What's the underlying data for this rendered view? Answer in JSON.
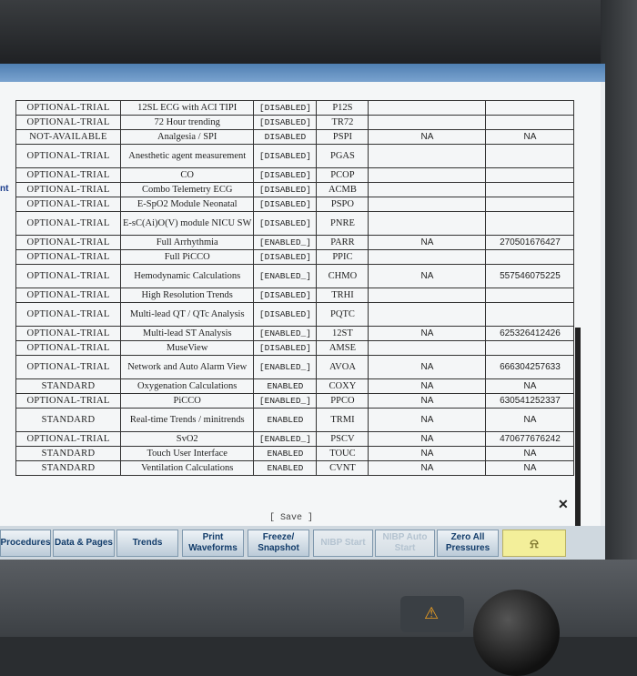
{
  "side_label": "nt",
  "rows": [
    {
      "status": "OPTIONAL-TRIAL",
      "option": "12SL ECG with ACI TIPI",
      "state": "[DISABLED]",
      "code": "P12S",
      "na": "",
      "key": ""
    },
    {
      "status": "OPTIONAL-TRIAL",
      "option": "72 Hour trending",
      "state": "[DISABLED]",
      "code": "TR72",
      "na": "",
      "key": ""
    },
    {
      "status": "NOT-AVAILABLE",
      "option": "Analgesia / SPI",
      "state": "DISABLED",
      "code": "PSPI",
      "na": "NA",
      "key": "NA"
    },
    {
      "status": "OPTIONAL-TRIAL",
      "option": "Anesthetic agent measurement",
      "state": "[DISABLED]",
      "code": "PGAS",
      "na": "",
      "key": ""
    },
    {
      "status": "OPTIONAL-TRIAL",
      "option": "CO",
      "state": "[DISABLED]",
      "code": "PCOP",
      "na": "",
      "key": ""
    },
    {
      "status": "OPTIONAL-TRIAL",
      "option": "Combo Telemetry ECG",
      "state": "[DISABLED]",
      "code": "ACMB",
      "na": "",
      "key": ""
    },
    {
      "status": "OPTIONAL-TRIAL",
      "option": "E-SpO2 Module Neonatal",
      "state": "[DISABLED]",
      "code": "PSPO",
      "na": "",
      "key": ""
    },
    {
      "status": "OPTIONAL-TRIAL",
      "option": "E-sC(Ai)O(V) module NICU SW",
      "state": "[DISABLED]",
      "code": "PNRE",
      "na": "",
      "key": ""
    },
    {
      "status": "OPTIONAL-TRIAL",
      "option": "Full Arrhythmia",
      "state": "[ENABLED_]",
      "code": "PARR",
      "na": "NA",
      "key": "270501676427"
    },
    {
      "status": "OPTIONAL-TRIAL",
      "option": "Full PiCCO",
      "state": "[DISABLED]",
      "code": "PPIC",
      "na": "",
      "key": ""
    },
    {
      "status": "OPTIONAL-TRIAL",
      "option": "Hemodynamic Calculations",
      "state": "[ENABLED_]",
      "code": "CHMO",
      "na": "NA",
      "key": "557546075225"
    },
    {
      "status": "OPTIONAL-TRIAL",
      "option": "High Resolution Trends",
      "state": "[DISABLED]",
      "code": "TRHI",
      "na": "",
      "key": ""
    },
    {
      "status": "OPTIONAL-TRIAL",
      "option": "Multi-lead QT / QTc Analysis",
      "state": "[DISABLED]",
      "code": "PQTC",
      "na": "",
      "key": ""
    },
    {
      "status": "OPTIONAL-TRIAL",
      "option": "Multi-lead ST Analysis",
      "state": "[ENABLED_]",
      "code": "12ST",
      "na": "NA",
      "key": "625326412426"
    },
    {
      "status": "OPTIONAL-TRIAL",
      "option": "MuseView",
      "state": "[DISABLED]",
      "code": "AMSE",
      "na": "",
      "key": ""
    },
    {
      "status": "OPTIONAL-TRIAL",
      "option": "Network and Auto Alarm View",
      "state": "[ENABLED_]",
      "code": "AVOA",
      "na": "NA",
      "key": "666304257633"
    },
    {
      "status": "STANDARD",
      "option": "Oxygenation Calculations",
      "state": "ENABLED",
      "code": "COXY",
      "na": "NA",
      "key": "NA"
    },
    {
      "status": "OPTIONAL-TRIAL",
      "option": "PiCCO",
      "state": "[ENABLED_]",
      "code": "PPCO",
      "na": "NA",
      "key": "630541252337"
    },
    {
      "status": "STANDARD",
      "option": "Real-time Trends / minitrends",
      "state": "ENABLED",
      "code": "TRMI",
      "na": "NA",
      "key": "NA"
    },
    {
      "status": "OPTIONAL-TRIAL",
      "option": "SvO2",
      "state": "[ENABLED_]",
      "code": "PSCV",
      "na": "NA",
      "key": "470677676242"
    },
    {
      "status": "STANDARD",
      "option": "Touch User Interface",
      "state": "ENABLED",
      "code": "TOUC",
      "na": "NA",
      "key": "NA"
    },
    {
      "status": "STANDARD",
      "option": "Ventilation Calculations",
      "state": "ENABLED",
      "code": "CVNT",
      "na": "NA",
      "key": "NA"
    }
  ],
  "save_label": "[ Save ]",
  "toolbar": {
    "procedures": "Procedures",
    "data_pages": "Data & Pages",
    "trends": "Trends",
    "print_waveforms": "Print Waveforms",
    "freeze_snapshot": "Freeze/ Snapshot",
    "nibp_start": "NIBP Start",
    "nibp_auto_start": "NIBP Auto Start",
    "zero_all_pressures": "Zero All Pressures",
    "alarm_icon": "bell-off-icon"
  },
  "colors": {
    "window_bar": "#4f7fb2",
    "alarm_button": "#f3ef9a",
    "button_text": "#123c6a"
  }
}
